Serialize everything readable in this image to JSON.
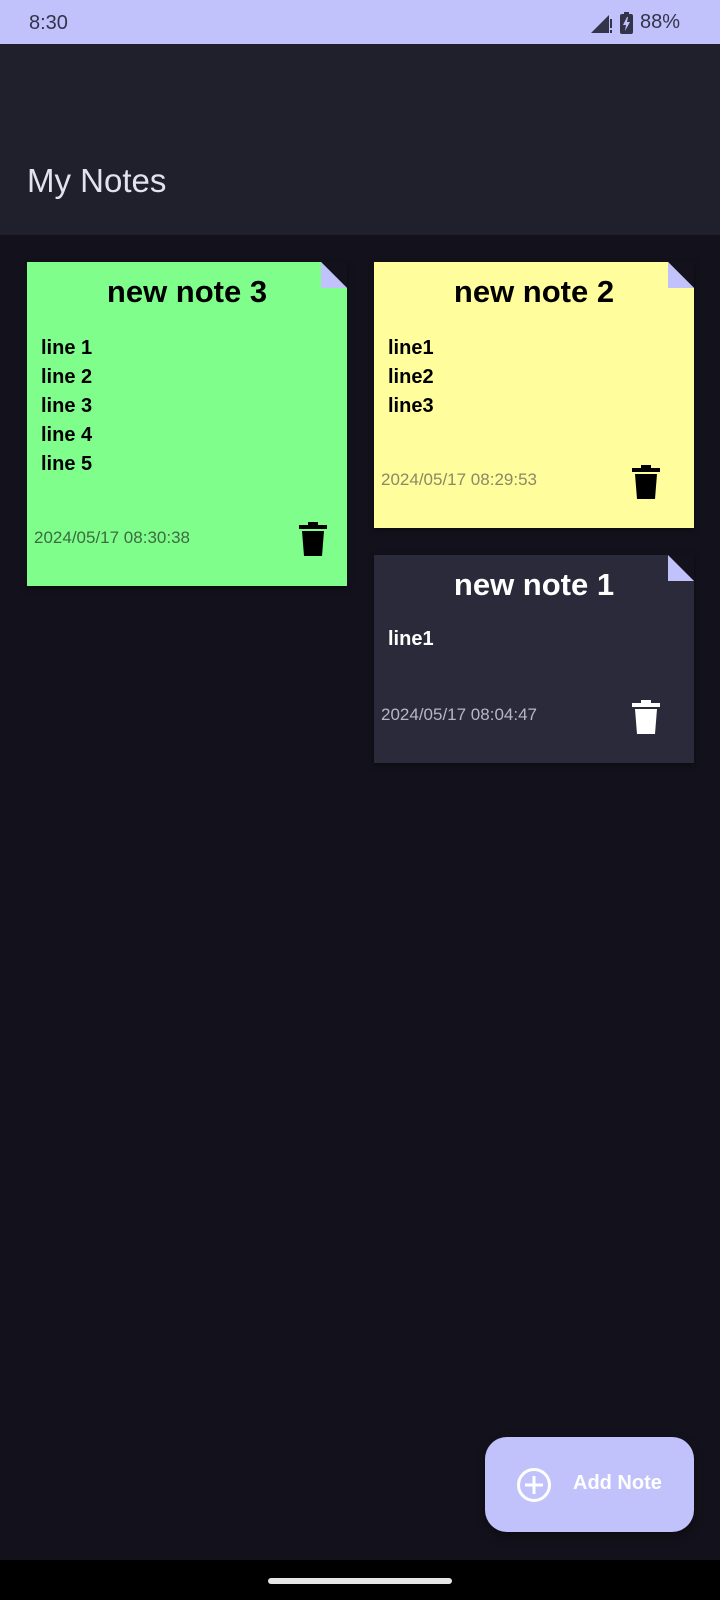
{
  "status_bar": {
    "time": "8:30",
    "battery": "88%",
    "icons": [
      "signal-icon",
      "battery-icon"
    ]
  },
  "app_bar": {
    "title": "My Notes"
  },
  "notes": [
    {
      "title": "new note 3",
      "lines": [
        "line 1",
        "line 2",
        "line 3",
        "line 4",
        "line 5"
      ],
      "date": "2024/05/17 08:30:38",
      "color": "#80fe8c",
      "text_color": "#000000",
      "icon": "trash-icon"
    },
    {
      "title": "new note 2",
      "lines": [
        "line1",
        "line2",
        "line3"
      ],
      "date": "2024/05/17 08:29:53",
      "color": "#fffd9c",
      "text_color": "#000000",
      "icon": "trash-icon"
    },
    {
      "title": "new note 1",
      "lines": [
        "line1"
      ],
      "date": "2024/05/17 08:04:47",
      "color": "#2b2a3a",
      "text_color": "#ffffff",
      "icon": "trash-icon"
    }
  ],
  "fab": {
    "label": "Add Note",
    "icon": "add-circle-icon"
  },
  "colors": {
    "accent": "#c1c2fb",
    "background": "#13121c",
    "app_bar": "#201f2c"
  }
}
